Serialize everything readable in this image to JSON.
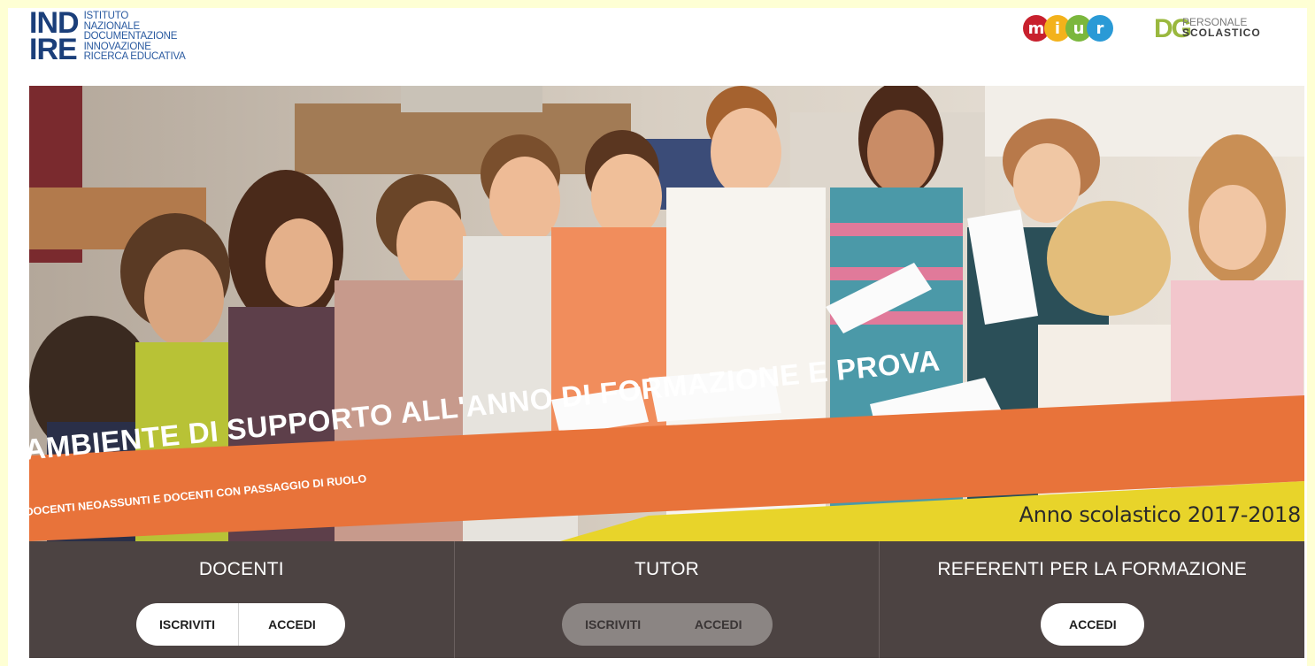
{
  "header": {
    "indire_mark_top": "IND",
    "indire_mark_bottom": "IRE",
    "indire_lines": [
      "ISTITUTO",
      "NAZIONALE",
      "DOCUMENTAZIONE",
      "INNOVAZIONE",
      "RICERCA EDUCATIVA"
    ],
    "miur_letters": [
      "m",
      "i",
      "u",
      "r"
    ],
    "miur_colors": [
      "#c8202d",
      "#f3b21b",
      "#7bb73d",
      "#2a9ad6"
    ],
    "dg_mark": "DG",
    "dg_line1": "PERSONALE",
    "dg_line2": "SCOLASTICO"
  },
  "hero": {
    "title": "AMBIENTE DI SUPPORTO ALL'ANNO DI FORMAZIONE E PROVA",
    "subtitle": "DOCENTI NEOASSUNTI E DOCENTI CON PASSAGGIO DI RUOLO",
    "year": "Anno scolastico 2017-2018",
    "colors": {
      "orange": "#e8733a",
      "yellow": "#e8d42a"
    }
  },
  "panels": [
    {
      "title": "DOCENTI",
      "buttons": [
        "ISCRIVITI",
        "ACCEDI"
      ],
      "style": "white"
    },
    {
      "title": "TUTOR",
      "buttons": [
        "ISCRIVITI",
        "ACCEDI"
      ],
      "style": "disabled"
    },
    {
      "title": "REFERENTI PER LA FORMAZIONE",
      "buttons": [
        "ACCEDI"
      ],
      "style": "white"
    }
  ]
}
